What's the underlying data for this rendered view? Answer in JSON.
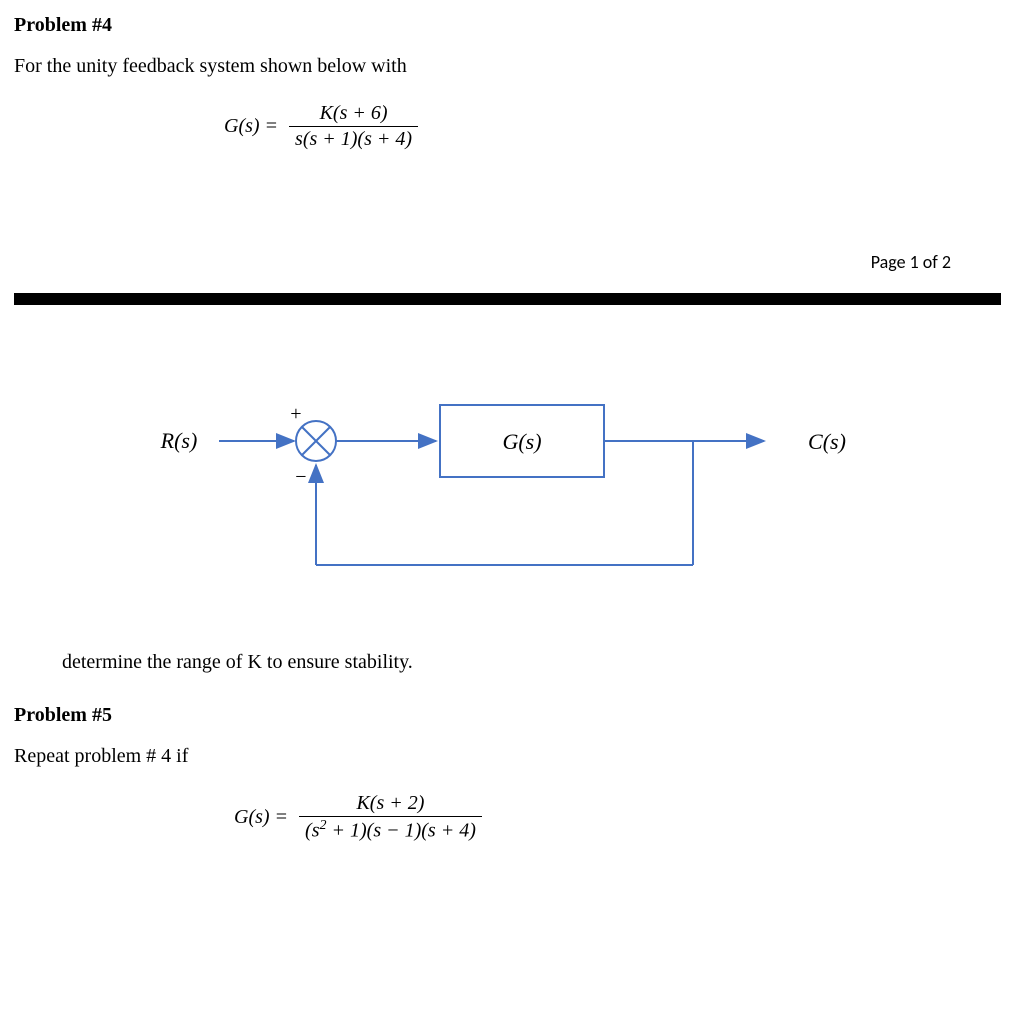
{
  "problem4": {
    "title": "Problem #4",
    "intro": "For the unity feedback system shown below with",
    "eq_lhs": "G(s) =",
    "eq_num": "K(s + 6)",
    "eq_den": "s(s + 1)(s + 4)",
    "task": "determine the range of K to ensure stability."
  },
  "page_indicator": "Page 1 of 2",
  "diagram": {
    "input_label": "R(s)",
    "block_label": "G(s)",
    "output_label": "C(s)",
    "plus": "+",
    "minus": "−",
    "color": "#4472C4"
  },
  "problem5": {
    "title": "Problem #5",
    "intro": "Repeat problem # 4 if",
    "eq_lhs": "G(s) =",
    "eq_num": "K(s + 2)",
    "eq_den_a": "(s",
    "eq_den_exp": "2",
    "eq_den_b": " + 1)(s − 1)(s + 4)"
  }
}
